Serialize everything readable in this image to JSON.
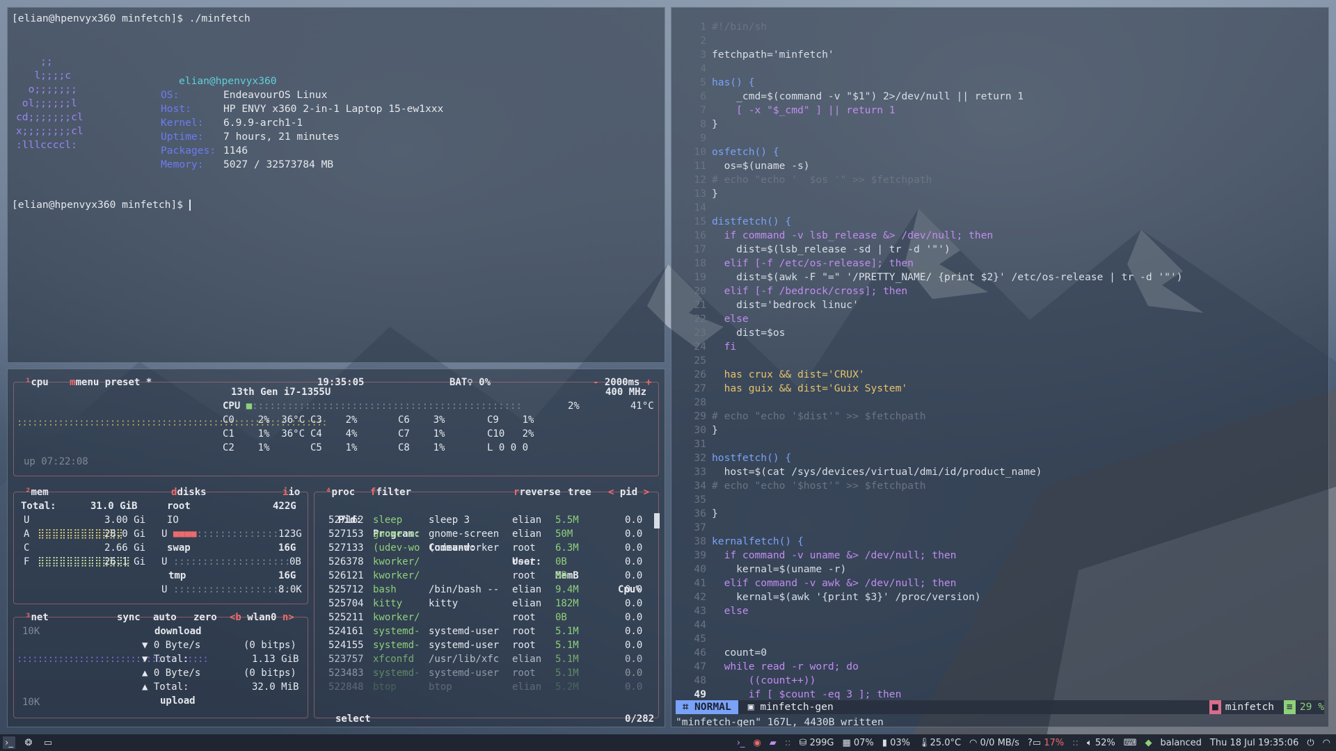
{
  "colors": {
    "accent": "#7aa2f7",
    "cyan": "#5fd0d8",
    "keyword": "#c28cf0",
    "string": "#8fd07a",
    "red": "#ec6b6b"
  },
  "terminal": {
    "cmd_line": "[elian@hpenvyx360 minfetch]$ ./minfetch",
    "user_host": "elian@hpenvyx360",
    "logo": [
      "    ;;",
      "   l;;;;c",
      "  o;;;;;;;",
      " ol;;;;;;l",
      "cd;;;;;;;cl",
      "x;;;;;;;;cl",
      ":lllccccl:"
    ],
    "info": [
      {
        "label": "OS:",
        "value": "EndeavourOS Linux"
      },
      {
        "label": "Host:",
        "value": "HP ENVY x360 2-in-1 Laptop 15-ew1xxx"
      },
      {
        "label": "Kernel:",
        "value": "6.9.9-arch1-1"
      },
      {
        "label": "Uptime:",
        "value": "7 hours, 21 minutes"
      },
      {
        "label": "Packages:",
        "value": "1146"
      },
      {
        "label": "Memory:",
        "value": "5027 / 32573784 MB"
      }
    ],
    "prompt": "[elian@hpenvyx360 minfetch]$ "
  },
  "btop": {
    "cpu": {
      "title": "cpu",
      "menu": "menu",
      "preset": "preset *",
      "clock": "19:35:05",
      "battery": "BAT♀ 0%",
      "interval": "2000ms",
      "model": "13th Gen i7-1355U",
      "freq": "400 MHz",
      "cpu_label": "CPU",
      "cpu_pct": "2%",
      "cpu_temp": "41°C",
      "cores_col1": [
        "C0    2%  36°C",
        "C1    1%  36°C",
        "C2    1%"
      ],
      "cores_col2": [
        "C3    2%",
        "C4    4%",
        "C5    1%"
      ],
      "cores_col3": [
        "C6    3%",
        "C7    1%",
        "C8    1%"
      ],
      "cores_col4": [
        "C9    1%",
        "C10   2%",
        "L 0 0 0"
      ],
      "uptime": "up 07:22:08"
    },
    "mem": {
      "title": "mem",
      "total_label": "Total:",
      "total": "31.0 GiB",
      "rows": [
        {
          "k": "U",
          "v": "3.00 Gi"
        },
        {
          "k": "A",
          "v": "28.0 Gi"
        },
        {
          "k": "C",
          "v": "2.66 Gi"
        },
        {
          "k": "F",
          "v": "26.1 Gi"
        }
      ]
    },
    "disks": {
      "title": "disks",
      "io": "io",
      "items": [
        {
          "name": "root",
          "size": "422G"
        },
        {
          "name": "swap",
          "size": "16G"
        },
        {
          "name": "tmp",
          "size": "16G"
        }
      ],
      "io_label": "IO",
      "root_used": "123G",
      "swap_used": "0B",
      "tmp_used": "8.0K"
    },
    "net": {
      "title": "net",
      "sync": "sync",
      "auto": "auto",
      "zero": "zero",
      "iface": "wlan0",
      "scale_top": "10K",
      "scale_bottom": "10K",
      "download": "download",
      "dl_rate": "0 Byte/s",
      "dl_bits": "(0 bitps)",
      "dl_total_label": "Total:",
      "dl_total": "1.13 GiB",
      "ul_rate": "0 Byte/s",
      "ul_bits": "(0 bitps)",
      "ul_total_label": "Total:",
      "ul_total": "32.0 MiB",
      "upload": "upload"
    },
    "proc": {
      "title": "proc",
      "filter": "filter",
      "reverse": "reverse",
      "tree": "tree",
      "sort": "pid",
      "headers": [
        "Pid:",
        "Program:",
        "Command:",
        "User:",
        "MemB",
        "Cpu%"
      ],
      "rows": [
        [
          "527162",
          "sleep",
          "sleep 3",
          "elian",
          "5.5M",
          "0.0"
        ],
        [
          "527153",
          "gnome-sc",
          "gnome-screen",
          "elian",
          "50M",
          "0.0"
        ],
        [
          "527133",
          "(udev-wo",
          "(udev-worker",
          "root",
          "6.3M",
          "0.0"
        ],
        [
          "526378",
          "kworker/",
          "",
          "root",
          "0B",
          "0.0"
        ],
        [
          "526121",
          "kworker/",
          "",
          "root",
          "0B",
          "0.0"
        ],
        [
          "525712",
          "bash",
          "/bin/bash --",
          "elian",
          "9.4M",
          "0.0"
        ],
        [
          "525704",
          "kitty",
          "kitty",
          "elian",
          "182M",
          "0.0"
        ],
        [
          "525211",
          "kworker/",
          "",
          "root",
          "0B",
          "0.0"
        ],
        [
          "524161",
          "systemd-",
          "systemd-user",
          "root",
          "5.1M",
          "0.0"
        ],
        [
          "524155",
          "systemd-",
          "systemd-user",
          "root",
          "5.1M",
          "0.0"
        ],
        [
          "523757",
          "xfconfd",
          "/usr/lib/xfc",
          "elian",
          "5.1M",
          "0.0"
        ],
        [
          "523483",
          "systemd-",
          "systemd-user",
          "root",
          "5.1M",
          "0.0"
        ],
        [
          "522848",
          "btop",
          "btop",
          "elian",
          "5.2M",
          "0.0"
        ]
      ],
      "select": "select",
      "count": "0/282"
    }
  },
  "editor": {
    "lines": [
      "#!/bin/sh",
      "",
      "fetchpath='minfetch'",
      "",
      "has() {",
      "    _cmd=$(command -v \"$1\") 2>/dev/null || return 1",
      "    [ -x \"$_cmd\" ] || return 1",
      "}",
      "",
      "osfetch() {",
      "  os=$(uname -s)",
      "# echo \"echo '  $os '\" >> $fetchpath",
      "}",
      "",
      "distfetch() {",
      "  if command -v lsb_release &> /dev/null; then",
      "    dist=$(lsb_release -sd | tr -d '\"')",
      "  elif [-f /etc/os-release]; then",
      "    dist=$(awk -F \"=\" '/PRETTY_NAME/ {print $2}' /etc/os-release | tr -d '\"')",
      "  elif [-f /bedrock/cross]; then",
      "    dist='bedrock linuc'",
      "  else",
      "    dist=$os",
      "  fi",
      "",
      "  has crux && dist='CRUX'",
      "  has guix && dist='Guix System'",
      "",
      "# echo \"echo '$dist'\" >> $fetchpath",
      "}",
      "",
      "hostfetch() {",
      "  host=$(cat /sys/devices/virtual/dmi/id/product_name)",
      "# echo \"echo '$host'\" >> $fetchpath",
      "",
      "}",
      "",
      "kernalfetch() {",
      "  if command -v uname &> /dev/null; then",
      "    kernal=$(uname -r)",
      "  elif command -v awk &> /dev/null; then",
      "    kernal=$(awk '{print $3}' /proc/version)",
      "  else",
      "",
      "",
      "  count=0",
      "  while read -r word; do",
      "      ((count++))",
      "      if [ $count -eq 3 ]; then"
    ],
    "current_line": "49",
    "mode": "NORMAL",
    "filename": "minfetch-gen",
    "project": "minfetch",
    "percent": "29 %",
    "message": "\"minfetch-gen\" 167L, 4430B written"
  },
  "taskbar": {
    "disk": "299G",
    "cpu": "07%",
    "mem": "03%",
    "temp": "25.0°C",
    "net": "0/0 MB/s",
    "battery": "17%",
    "volume": "52%",
    "power_profile": "balanced",
    "datetime": "Thu 18 Jul 19:35:06"
  }
}
